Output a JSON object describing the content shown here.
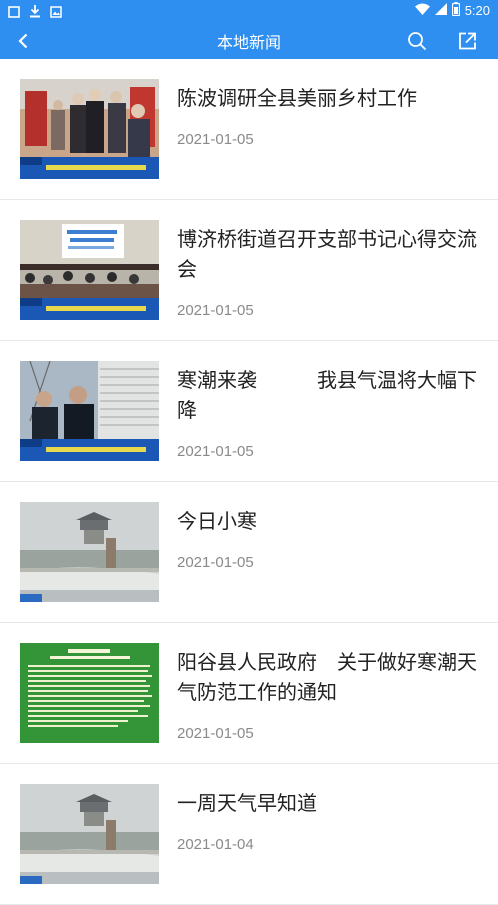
{
  "status_bar": {
    "time": "5:20"
  },
  "header": {
    "title": "本地新闻",
    "back_icon": "back-chevron-icon",
    "search_icon": "search-icon",
    "share_icon": "share-icon",
    "color": "#2f8ff0"
  },
  "news": [
    {
      "title": "陈波调研全县美丽乡村工作",
      "date": "2021-01-05"
    },
    {
      "title": "博济桥街道召开支部书记心得交流会",
      "date": "2021-01-05"
    },
    {
      "title": "寒潮来袭　　　我县气温将大幅下降",
      "date": "2021-01-05"
    },
    {
      "title": "今日小寒",
      "date": "2021-01-05"
    },
    {
      "title": "阳谷县人民政府　关于做好寒潮天气防范工作的通知",
      "date": "2021-01-05"
    },
    {
      "title": "一周天气早知道",
      "date": "2021-01-04"
    }
  ]
}
